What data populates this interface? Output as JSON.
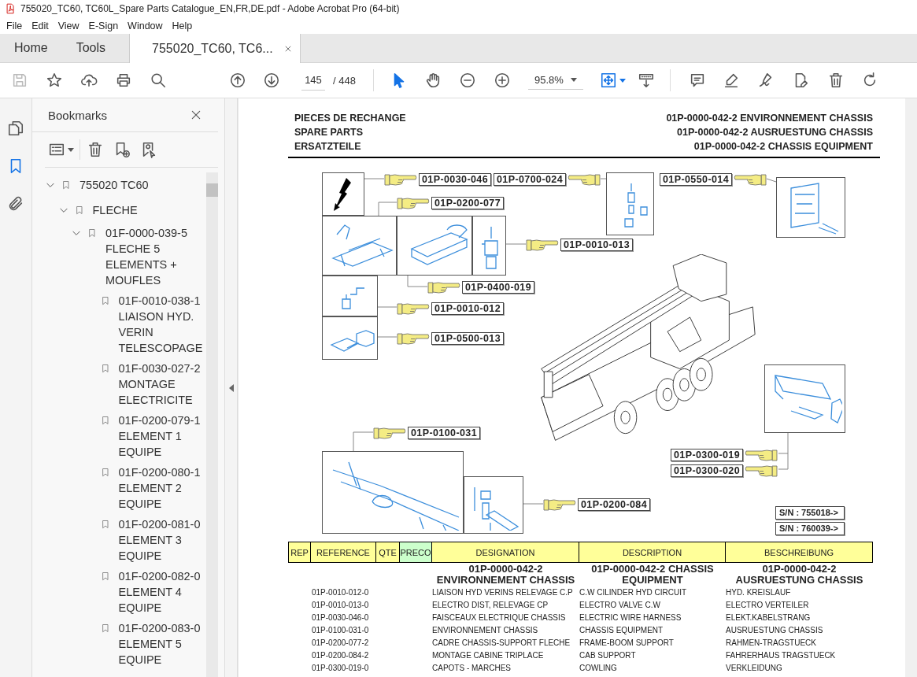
{
  "window": {
    "title": "755020_TC60, TC60L_Spare Parts Catalogue_EN,FR,DE.pdf - Adobe Acrobat Pro (64-bit)"
  },
  "menu": [
    "File",
    "Edit",
    "View",
    "E-Sign",
    "Window",
    "Help"
  ],
  "tabs": [
    {
      "label": "Home",
      "selected": false
    },
    {
      "label": "Tools",
      "selected": false
    },
    {
      "label": "755020_TC60, TC6...",
      "selected": true
    }
  ],
  "toolbar": {
    "page": "145",
    "total": "/ 448",
    "zoom": "95.8%"
  },
  "side_panel": {
    "title": "Bookmarks",
    "bookmarks": [
      {
        "label": "755020 TC60",
        "expanded": true,
        "children": [
          {
            "label": "FLECHE",
            "expanded": true,
            "children": [
              {
                "label": "01F-0000-039-5 FLECHE 5 ELEMENTS + MOUFLES",
                "expanded": true,
                "children": [
                  {
                    "label": "01F-0010-038-1 LIAISON HYD. VERIN TELESCOPAGE"
                  },
                  {
                    "label": "01F-0030-027-2 MONTAGE ELECTRICITE"
                  },
                  {
                    "label": "01F-0200-079-1 ELEMENT 1 EQUIPE"
                  },
                  {
                    "label": "01F-0200-080-1 ELEMENT 2 EQUIPE"
                  },
                  {
                    "label": "01F-0200-081-0 ELEMENT 3 EQUIPE"
                  },
                  {
                    "label": "01F-0200-082-0 ELEMENT 4 EQUIPE"
                  },
                  {
                    "label": "01F-0200-083-0 ELEMENT 5 EQUIPE"
                  }
                ]
              }
            ]
          }
        ]
      }
    ]
  },
  "document": {
    "header_left": [
      "PIECES DE RECHANGE",
      "SPARE PARTS",
      "ERSATZTEILE"
    ],
    "header_right": [
      "01P-0000-042-2 ENVIRONNEMENT CHASSIS",
      "01P-0000-042-2 AUSRUESTUNG CHASSIS",
      "01P-0000-042-2 CHASSIS EQUIPMENT"
    ],
    "callouts": [
      {
        "text": "01P-0030-046",
        "kind": "hand-left"
      },
      {
        "text": "01P-0700-024",
        "kind": "hand-right"
      },
      {
        "text": "01P-0550-014",
        "kind": "hand-right"
      },
      {
        "text": "01P-0200-077",
        "kind": "hand-left"
      },
      {
        "text": "01P-0010-013",
        "kind": "hand-left"
      },
      {
        "text": "01P-0400-019",
        "kind": "hand-left"
      },
      {
        "text": "01P-0010-012",
        "kind": "hand-left"
      },
      {
        "text": "01P-0500-013",
        "kind": "hand-left"
      },
      {
        "text": "01P-0100-031",
        "kind": "hand-left"
      },
      {
        "text": "01P-0300-019",
        "kind": "hand-right"
      },
      {
        "text": "01P-0300-020",
        "kind": "hand-right"
      },
      {
        "text": "01P-0200-084",
        "kind": "hand-left"
      }
    ],
    "serial_numbers": [
      "S/N : 755018->",
      "S/N : 760039->"
    ],
    "table": {
      "columns": [
        {
          "label": "REP",
          "color": "#ffff99"
        },
        {
          "label": "REFERENCE",
          "color": "#ffff99"
        },
        {
          "label": "QTE",
          "color": "#ffff99"
        },
        {
          "label": "PRECO",
          "color": "#ccffcc"
        },
        {
          "label": "DESIGNATION",
          "color": "#ffff99"
        },
        {
          "label": "DESCRIPTION",
          "color": "#ffff99"
        },
        {
          "label": "BESCHREIBUNG",
          "color": "#ffff99"
        }
      ],
      "group": {
        "designation": "01P-0000-042-2 ENVIRONNEMENT CHASSIS",
        "description": "01P-0000-042-2 CHASSIS EQUIPMENT",
        "beschreibung": "01P-0000-042-2 AUSRUESTUNG CHASSIS"
      },
      "rows": [
        {
          "reference": "01P-0010-012-0",
          "designation": "LIAISON HYD VERINS RELEVAGE C.P",
          "description": "C.W CILINDER HYD CIRCUIT",
          "beschreibung": "HYD. KREISLAUF"
        },
        {
          "reference": "01P-0010-013-0",
          "designation": "ELECTRO DIST, RELEVAGE CP",
          "description": "ELECTRO VALVE C.W",
          "beschreibung": "ELECTRO VERTEILER"
        },
        {
          "reference": "01P-0030-046-0",
          "designation": "FAISCEAUX ELECTRIQUE CHASSIS",
          "description": "ELECTRIC WIRE HARNESS",
          "beschreibung": "ELEKT.KABELSTRANG"
        },
        {
          "reference": "01P-0100-031-0",
          "designation": "ENVIRONNEMENT CHASSIS",
          "description": "CHASSIS EQUIPMENT",
          "beschreibung": "AUSRUESTUNG CHASSIS"
        },
        {
          "reference": "01P-0200-077-2",
          "designation": "CADRE CHASSIS-SUPPORT FLECHE",
          "description": "FRAME-BOOM SUPPORT",
          "beschreibung": "RAHMEN-TRAGSTUECK"
        },
        {
          "reference": "01P-0200-084-2",
          "designation": "MONTAGE CABINE TRIPLACE",
          "description": "CAB SUPPORT",
          "beschreibung": "FAHRERHAUS TRAGSTUECK"
        },
        {
          "reference": "01P-0300-019-0",
          "designation": "CAPOTS - MARCHES",
          "description": "COWLING",
          "beschreibung": "VERKLEIDUNG"
        }
      ]
    }
  }
}
